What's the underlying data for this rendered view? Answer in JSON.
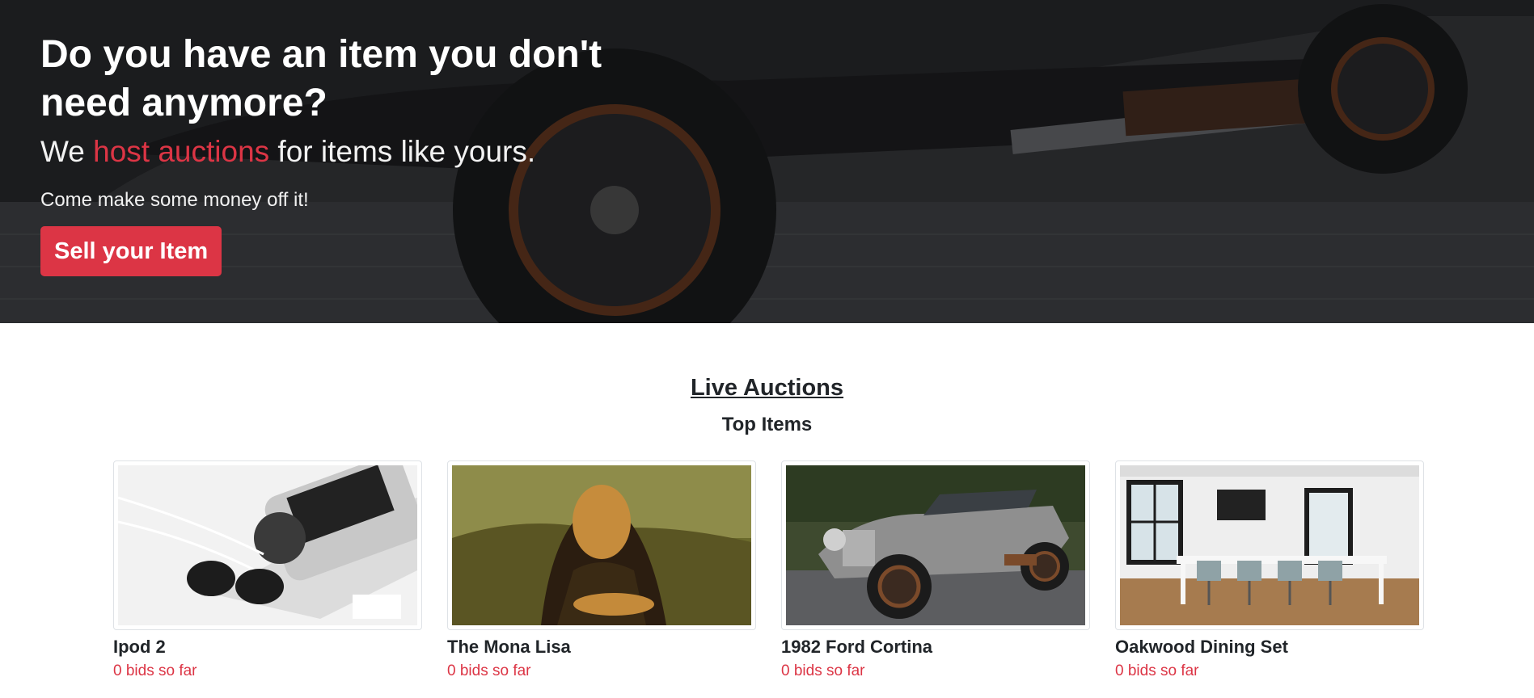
{
  "hero": {
    "title": "Do you have an item you don't need anymore?",
    "subtitle_prefix": "We ",
    "subtitle_accent": "host auctions",
    "subtitle_suffix": " for items like yours.",
    "lead": "Come make some money off it!",
    "cta_label": "Sell your Item",
    "background_image": "vintage-car-photo",
    "accent_color": "#dc3545"
  },
  "auctions": {
    "heading": "Live Auctions",
    "subheading": "Top Items",
    "items": [
      {
        "name": "Ipod 2",
        "bids": "0 bids so far",
        "image": "ipod-earbuds-photo"
      },
      {
        "name": "The Mona Lisa",
        "bids": "0 bids so far",
        "image": "mona-lisa-painting"
      },
      {
        "name": "1982 Ford Cortina",
        "bids": "0 bids so far",
        "image": "vintage-car-photo"
      },
      {
        "name": "Oakwood Dining Set",
        "bids": "0 bids so far",
        "image": "dining-room-photo"
      }
    ]
  }
}
